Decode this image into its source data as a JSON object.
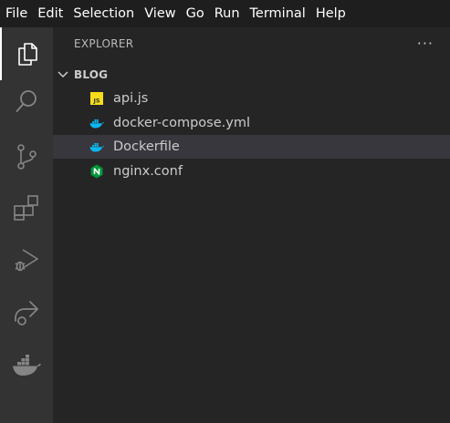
{
  "menu": [
    "File",
    "Edit",
    "Selection",
    "View",
    "Go",
    "Run",
    "Terminal",
    "Help"
  ],
  "activity_bar": {
    "items": [
      {
        "icon": "files-icon",
        "active": true
      },
      {
        "icon": "search-icon"
      },
      {
        "icon": "source-control-icon"
      },
      {
        "icon": "extensions-icon"
      },
      {
        "icon": "run-debug-icon"
      },
      {
        "icon": "remote-explorer-icon"
      },
      {
        "icon": "docker-icon"
      }
    ]
  },
  "explorer": {
    "title": "EXPLORER",
    "more_actions": "···",
    "folder": "BLOG",
    "files": [
      {
        "name": "api.js",
        "icon": "javascript-icon"
      },
      {
        "name": "docker-compose.yml",
        "icon": "docker-icon"
      },
      {
        "name": "Dockerfile",
        "icon": "docker-icon",
        "selected": true
      },
      {
        "name": "nginx.conf",
        "icon": "nginx-icon"
      }
    ]
  },
  "colors": {
    "menubar_bg": "#1e1e1e",
    "activitybar_bg": "#333333",
    "sidebar_bg": "#252526",
    "selection_bg": "#37373d",
    "js_yellow": "#f5de19",
    "docker_blue": "#0db7ed",
    "nginx_green": "#009639"
  }
}
